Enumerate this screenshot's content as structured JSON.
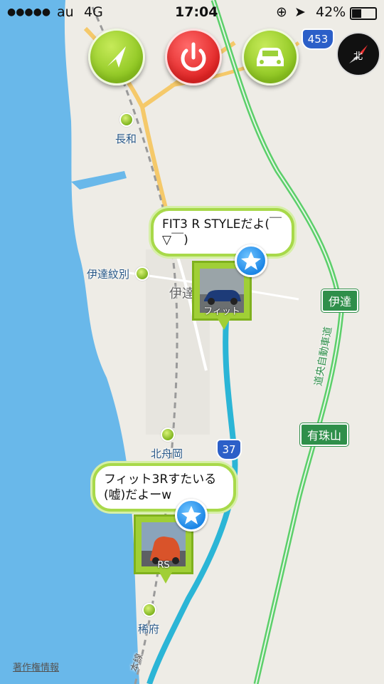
{
  "status_bar": {
    "signal": "●●●●●",
    "carrier": "au",
    "network": "4G",
    "time": "17:04",
    "battery_percent": "42%"
  },
  "controls": {
    "navigate": "navigate-arrow-icon",
    "power": "power-icon",
    "car": "car-icon"
  },
  "map": {
    "place_labels": {
      "nagawa": "長和",
      "datemonbetsu": "伊達紋別",
      "date_town": "伊達",
      "kitafunaoka": "北舟岡",
      "marefu": "稀府"
    },
    "highway_labels": {
      "date_ic": "伊達",
      "usuyama": "有珠山",
      "expressway_name": "道央自動車道"
    },
    "route_shields": {
      "r453": "453",
      "r37": "37"
    },
    "rail_label": "本線",
    "compass_label": "北",
    "legal_link": "著作権情報"
  },
  "posts": [
    {
      "message": "FIT3 R STYLEだよ(￣▽￣)",
      "caption": "フィット"
    },
    {
      "message": "フィット3Rすたいる(嘘)だよーw",
      "caption": "RS"
    }
  ],
  "colors": {
    "sea": "#69b8ea",
    "expressway": "#5ccf6a",
    "route_line": "#2bb5d6",
    "accent_green": "#a0cf36",
    "power_red": "#e12424"
  }
}
